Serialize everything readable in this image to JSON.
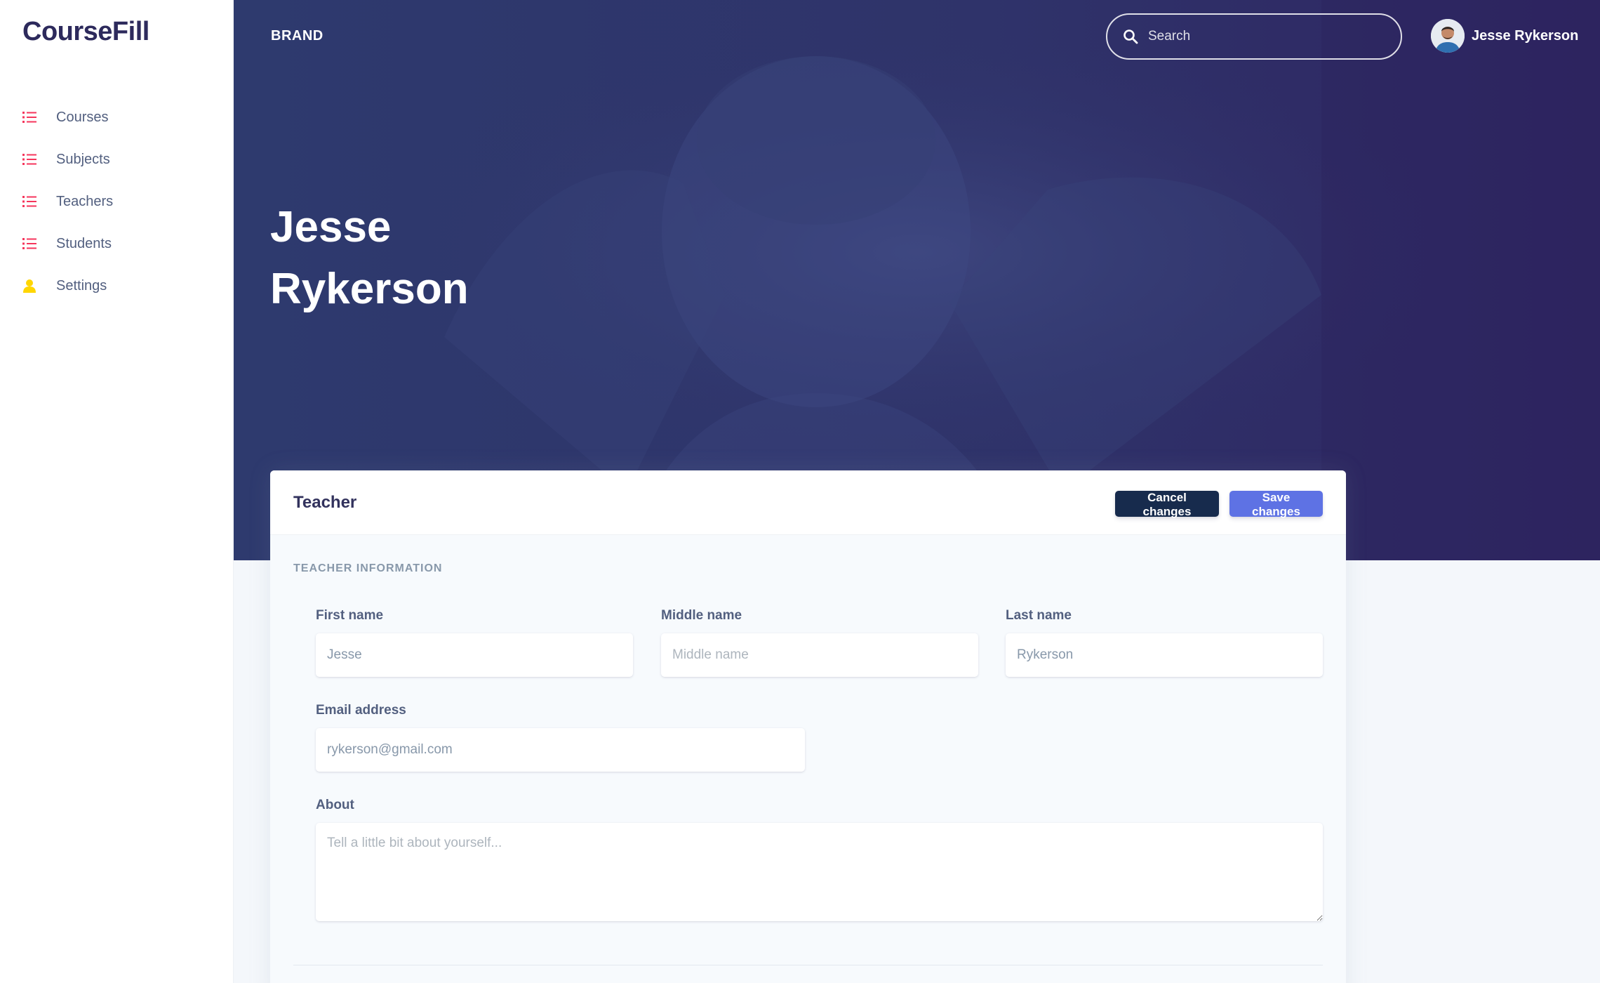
{
  "sidebar": {
    "logo": "CourseFill",
    "items": [
      {
        "label": "Courses",
        "icon": "list-icon"
      },
      {
        "label": "Subjects",
        "icon": "list-icon"
      },
      {
        "label": "Teachers",
        "icon": "list-icon"
      },
      {
        "label": "Students",
        "icon": "list-icon"
      },
      {
        "label": "Settings",
        "icon": "user-icon"
      }
    ]
  },
  "header": {
    "brand": "BRAND",
    "search_placeholder": "Search",
    "user_name": "Jesse Rykerson"
  },
  "hero": {
    "first_line": "Jesse",
    "second_line": "Rykerson"
  },
  "card": {
    "title": "Teacher",
    "cancel_label": "Cancel changes",
    "save_label": "Save changes",
    "section_heading": "TEACHER INFORMATION",
    "fields": {
      "first_name": {
        "label": "First name",
        "value": "Jesse",
        "placeholder": "First name"
      },
      "middle_name": {
        "label": "Middle name",
        "value": "",
        "placeholder": "Middle name"
      },
      "last_name": {
        "label": "Last name",
        "value": "Rykerson",
        "placeholder": "Last name"
      },
      "email": {
        "label": "Email address",
        "value": "rykerson@gmail.com",
        "placeholder": "Email address"
      },
      "about": {
        "label": "About",
        "value": "",
        "placeholder": "Tell a little bit about yourself..."
      }
    }
  },
  "colors": {
    "brand_dark": "#2d2a5c",
    "list_icon": "#f5365c",
    "settings_icon": "#ffd600",
    "hero_bg": "#2f336a",
    "cancel_button": "#172b4d",
    "save_button": "#5e72e4"
  }
}
